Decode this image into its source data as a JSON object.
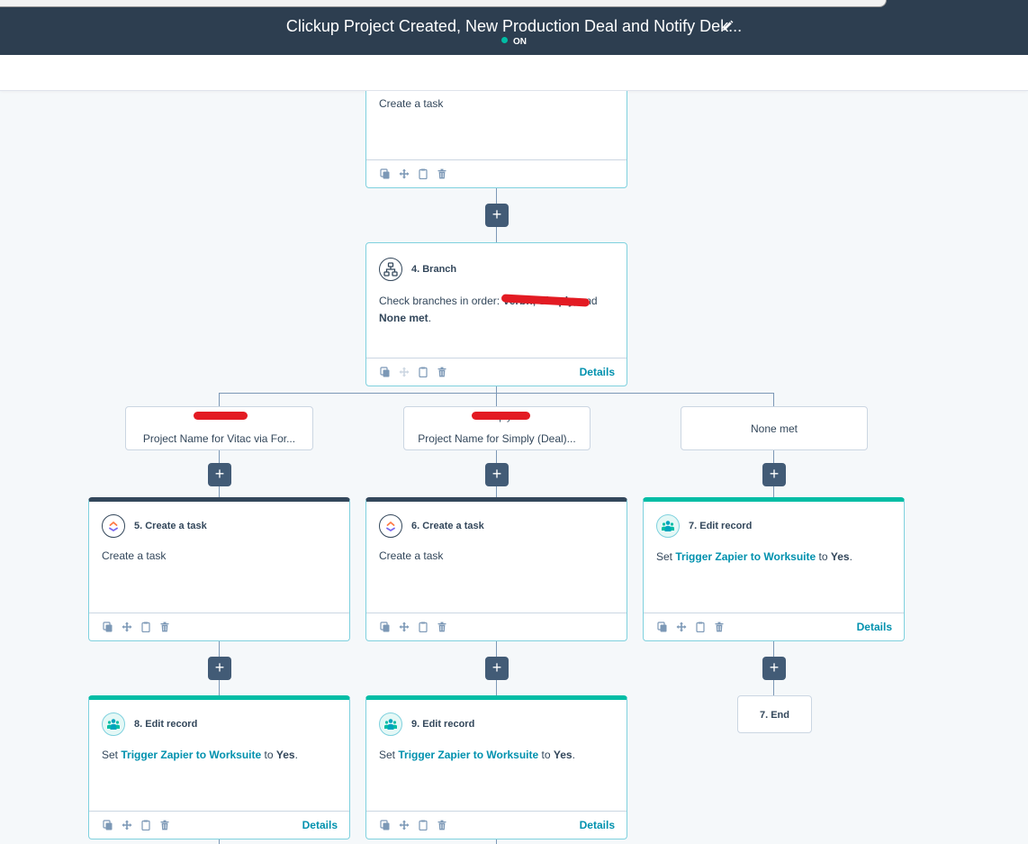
{
  "header": {
    "title": "Clickup Project Created, New Production Deal and Notify Dek...",
    "status": "ON",
    "edit_icon": "pencil-icon"
  },
  "colors": {
    "header_bg": "#2d3e50",
    "accent_teal": "#00bda5",
    "link": "#0091ae",
    "plus_button": "#425b76",
    "card_border": "#7fd1de",
    "redaction": "#e31b23"
  },
  "steps": {
    "step3": {
      "description": "Create a task"
    },
    "step4": {
      "label": "4. Branch",
      "desc_prefix": "Check branches in order: ",
      "desc_redacted": "Verbn, Simply,",
      "desc_and": " and",
      "desc_none": "None met",
      "desc_period": ".",
      "details": "Details"
    },
    "step5": {
      "label": "5. Create a task",
      "description": "Create a task"
    },
    "step6": {
      "label": "6. Create a task",
      "description": "Create a task"
    },
    "step7": {
      "label": "7. Edit record",
      "set": "Set ",
      "property": "Trigger Zapier to Worksuite",
      "to": " to ",
      "value": "Yes",
      "period": ".",
      "details": "Details"
    },
    "step8": {
      "label": "8. Edit record",
      "set": "Set ",
      "property": "Trigger Zapier to Worksuite",
      "to": " to ",
      "value": "Yes",
      "period": ".",
      "details": "Details"
    },
    "step9": {
      "label": "9. Edit record",
      "set": "Set ",
      "property": "Trigger Zapier to Worksuite",
      "to": " to ",
      "value": "Yes",
      "period": ".",
      "details": "Details"
    },
    "end": {
      "label": "7. End"
    }
  },
  "branches": [
    {
      "name": "Verbn",
      "subtitle": "Project Name for Vitac via For..."
    },
    {
      "name": "Simply",
      "subtitle": "Project Name for Simply (Deal)..."
    },
    {
      "name": "None met",
      "subtitle": ""
    }
  ],
  "icons": {
    "tools": [
      "copy-icon",
      "move-icon",
      "clipboard-icon",
      "trash-icon"
    ],
    "branch": "branch-icon",
    "clickup": "clickup-icon",
    "hubspot": "people-icon",
    "add": "+"
  }
}
